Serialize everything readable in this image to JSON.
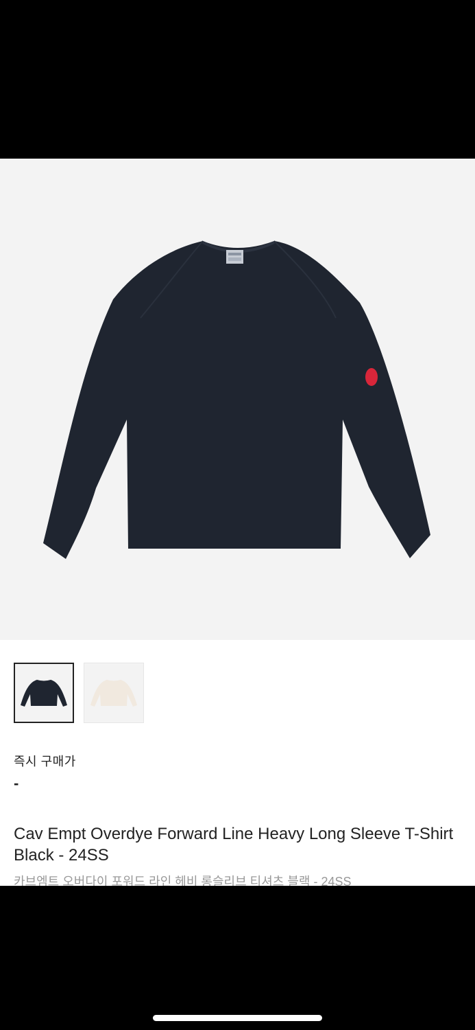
{
  "product": {
    "images": [
      {
        "label": "Black",
        "color": "#1f2530"
      },
      {
        "label": "Ivory",
        "color": "#f1e9df"
      }
    ],
    "selected_image_index": 0,
    "patch_color": "#d8263a",
    "price_label": "즉시 구매가",
    "price_value": "-",
    "title": "Cav Empt Overdye Forward Line Heavy Long Sleeve T-Shirt Black - 24SS",
    "subtitle_ko": "카브엠트 오버다이 포워드 라인 헤비 롱슬리브 티셔츠 블랙 - 24SS"
  }
}
